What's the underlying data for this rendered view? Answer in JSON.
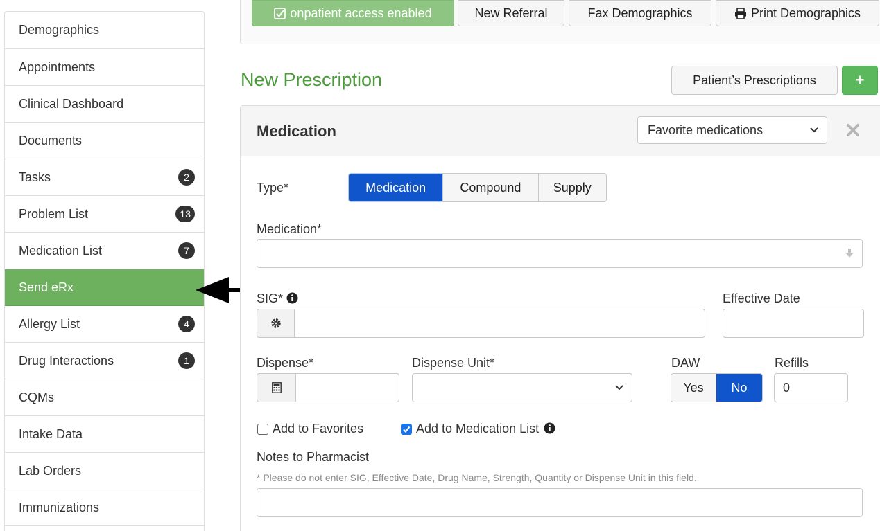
{
  "sidebar": {
    "items": [
      {
        "label": "Demographics",
        "badge": ""
      },
      {
        "label": "Appointments",
        "badge": ""
      },
      {
        "label": "Clinical Dashboard",
        "badge": ""
      },
      {
        "label": "Documents",
        "badge": ""
      },
      {
        "label": "Tasks",
        "badge": "2"
      },
      {
        "label": "Problem List",
        "badge": "13"
      },
      {
        "label": "Medication List",
        "badge": "7"
      },
      {
        "label": "Send eRx",
        "badge": "",
        "active": true
      },
      {
        "label": "Allergy List",
        "badge": "4"
      },
      {
        "label": "Drug Interactions",
        "badge": "1"
      },
      {
        "label": "CQMs",
        "badge": ""
      },
      {
        "label": "Intake Data",
        "badge": ""
      },
      {
        "label": "Lab Orders",
        "badge": ""
      },
      {
        "label": "Immunizations",
        "badge": ""
      }
    ]
  },
  "toolbar": {
    "onpatient_label": "onpatient access enabled",
    "new_referral_label": "New Referral",
    "fax_label": "Fax Demographics",
    "print_label": "Print Demographics"
  },
  "page": {
    "title": "New Prescription",
    "patients_prescriptions_label": "Patient’s Prescriptions",
    "add_label": "+"
  },
  "medication_panel": {
    "title": "Medication",
    "favorites_select": "Favorite medications",
    "type_label": "Type*",
    "type_options": [
      "Medication",
      "Compound",
      "Supply"
    ],
    "type_selected": "Medication",
    "medication_label": "Medication*",
    "medication_value": "",
    "sig_label": "SIG*",
    "sig_value": "",
    "effective_date_label": "Effective Date",
    "effective_date_value": "",
    "dispense_label": "Dispense*",
    "dispense_value": "",
    "dispense_unit_label": "Dispense Unit*",
    "dispense_unit_value": "",
    "daw_label": "DAW",
    "daw_options": [
      "Yes",
      "No"
    ],
    "daw_selected": "No",
    "refills_label": "Refills",
    "refills_value": "0",
    "add_favorites_label": "Add to Favorites",
    "add_favorites_checked": false,
    "add_med_list_label": "Add to Medication List",
    "add_med_list_checked": true,
    "notes_label": "Notes to Pharmacist",
    "notes_hint": "* Please do not enter SIG, Effective Date, Drug Name, Strength, Quantity or Dispense Unit in this field.",
    "notes_value": ""
  },
  "colors": {
    "brand_green": "#6db15e",
    "title_green": "#4c9a3c",
    "selected_blue": "#1155cc",
    "badge_dark": "#333333"
  }
}
